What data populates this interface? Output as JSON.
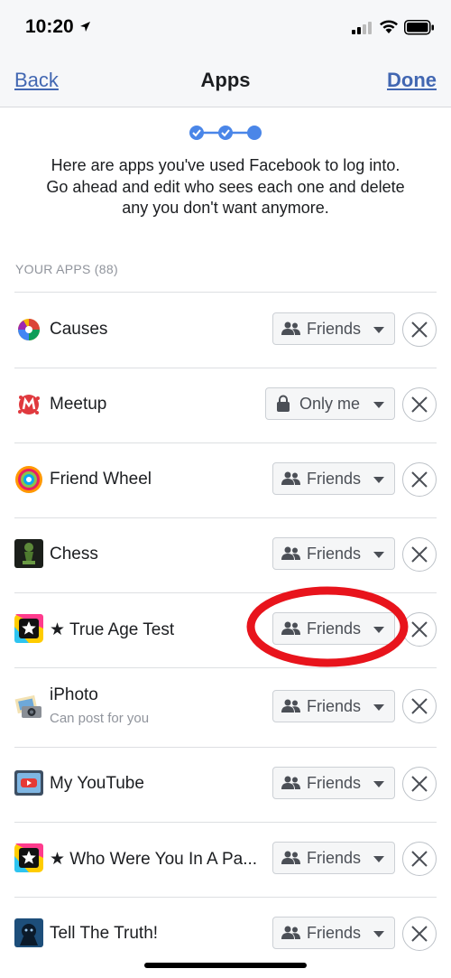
{
  "status_bar": {
    "time": "10:20"
  },
  "nav": {
    "back_label": "Back",
    "title": "Apps",
    "done_label": "Done"
  },
  "intro": {
    "lines": [
      "Here are apps you've used Facebook to log into.",
      "Go ahead and edit who sees each one and delete",
      "any you don't want anymore."
    ]
  },
  "section": {
    "header": "YOUR APPS (88)"
  },
  "apps": [
    {
      "name": "Causes",
      "sub": "",
      "audience": "Friends",
      "icon": "causes-icon"
    },
    {
      "name": "Meetup",
      "sub": "",
      "audience": "Only me",
      "icon": "meetup-icon"
    },
    {
      "name": "Friend Wheel",
      "sub": "",
      "audience": "Friends",
      "icon": "friend-wheel-icon"
    },
    {
      "name": "Chess",
      "sub": "",
      "audience": "Friends",
      "icon": "chess-icon"
    },
    {
      "name": "★ True Age Test",
      "sub": "",
      "audience": "Friends",
      "icon": "star-app-icon"
    },
    {
      "name": "iPhoto",
      "sub": "Can post for you",
      "audience": "Friends",
      "icon": "iphoto-icon"
    },
    {
      "name": "My YouTube",
      "sub": "",
      "audience": "Friends",
      "icon": "youtube-tv-icon"
    },
    {
      "name": "★ Who Were You In A Pa...",
      "sub": "",
      "audience": "Friends",
      "icon": "star-app-icon"
    },
    {
      "name": "Tell The Truth!",
      "sub": "",
      "audience": "Friends",
      "icon": "tell-truth-icon"
    }
  ],
  "colors": {
    "link": "#4267b2",
    "highlight_ring": "#e8141c",
    "progress": "#4a86e8"
  }
}
